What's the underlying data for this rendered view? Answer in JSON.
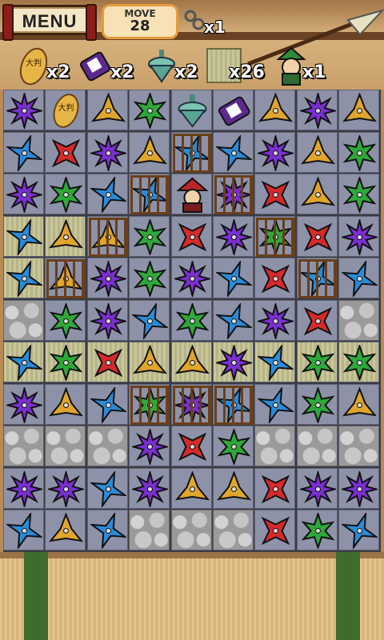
{
  "header": {
    "menu_label": "MENU",
    "move_title": "MOVE",
    "move_count": "28",
    "chain_count": "x1"
  },
  "goals": [
    {
      "icon": "gold-coin-icon",
      "count": "x2"
    },
    {
      "icon": "purple-scroll-icon",
      "count": "x2"
    },
    {
      "icon": "spinning-top-icon",
      "count": "x2"
    },
    {
      "icon": "tatami-tile-icon",
      "count": "x26"
    },
    {
      "icon": "ninja-rescue-icon",
      "count": "x1"
    }
  ],
  "special_tokens": {
    "coin_text": "大判"
  },
  "colors": {
    "purple": "#7a2fd0",
    "blue": "#2a8bd9",
    "red": "#d62a2a",
    "green": "#2fa83a",
    "gold": "#e0a52c"
  },
  "board": {
    "rows": [
      [
        "P.",
        "C.",
        "Y.",
        "G.",
        "T.",
        "S.",
        "Y.",
        "P.",
        "Y."
      ],
      [
        "B.",
        "R.",
        "P.",
        "Y.",
        "Bc",
        "B.",
        "P.",
        "Y.",
        "G."
      ],
      [
        "P.",
        "G.",
        "B.",
        "Bc",
        "N.",
        "Pc",
        "R.",
        "Y.",
        "G."
      ],
      [
        "Bt",
        "Yt",
        "Yc",
        "G.",
        "R.",
        "P.",
        "Gc",
        "R.",
        "P."
      ],
      [
        "Bt",
        "Yc",
        "P.",
        "G.",
        "P.",
        "B.",
        "R.",
        "Bc",
        "B."
      ],
      [
        "X.",
        "G.",
        "P.",
        "B.",
        "G.",
        "B.",
        "P.",
        "R.",
        "X."
      ],
      [
        "Bt",
        "Gt",
        "Rt",
        "Yt",
        "Yt",
        "Pt",
        "Bt",
        "Gt",
        "Gt"
      ],
      [
        "P.",
        "Y.",
        "B.",
        "Gc",
        "Pc",
        "Bc",
        "B.",
        "G.",
        "Y."
      ],
      [
        "X.",
        "X.",
        "X.",
        "P.",
        "R.",
        "G.",
        "X.",
        "X.",
        "X."
      ],
      [
        "P.",
        "P.",
        "B.",
        "P.",
        "Y.",
        "Y.",
        "R.",
        "P.",
        "P."
      ],
      [
        "B.",
        "Y.",
        "B.",
        "X.",
        "X.",
        "X.",
        "R.",
        "G.",
        "B."
      ]
    ]
  }
}
